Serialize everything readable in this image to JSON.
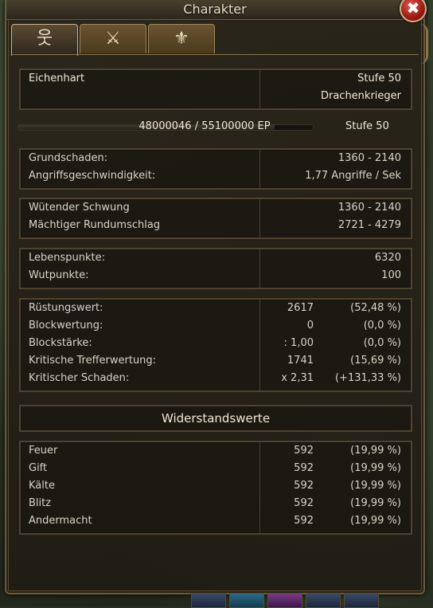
{
  "window": {
    "title": "Charakter",
    "close_symbol": "✖"
  },
  "tabs": [
    {
      "icon": "person-icon",
      "glyph": "웃",
      "active": true
    },
    {
      "icon": "crossed-swords-icon",
      "glyph": "⚔",
      "active": false
    },
    {
      "icon": "medal-icon",
      "glyph": "⚜",
      "active": false
    }
  ],
  "character": {
    "name": "Eichenhart",
    "level_label": "Stufe 50",
    "class": "Drachenkrieger"
  },
  "experience": {
    "text": "48000046 / 55100000 EP",
    "current": 48000046,
    "max": 55100000,
    "fraction": 0.8711,
    "level_label": "Stufe 50"
  },
  "damage": [
    {
      "label": "Grundschaden:",
      "value": "1360 - 2140"
    },
    {
      "label": "Angriffsgeschwindigkeit:",
      "value": "1,77 Angriffe / Sek"
    }
  ],
  "skills": [
    {
      "label": "Wütender Schwung",
      "value": "1360 - 2140"
    },
    {
      "label": "Mächtiger Rundumschlag",
      "value": "2721 - 4279"
    }
  ],
  "resources": [
    {
      "label": "Lebenspunkte:",
      "value": "6320"
    },
    {
      "label": "Wutpunkte:",
      "value": "100"
    }
  ],
  "defense": [
    {
      "label": "Rüstungswert:",
      "value": "2617",
      "pct": "(52,48 %)"
    },
    {
      "label": "Blockwertung:",
      "value": "0",
      "pct": "(0,0 %)"
    },
    {
      "label": "Blockstärke:",
      "value": ": 1,00",
      "pct": "(0,0 %)"
    },
    {
      "label": "Kritische Trefferwertung:",
      "value": "1741",
      "pct": "(15,69 %)"
    },
    {
      "label": "Kritischer Schaden:",
      "value": "x 2,31",
      "pct": "(+131,33 %)"
    }
  ],
  "resistances_title": "Widerstandswerte",
  "resistances": [
    {
      "label": "Feuer",
      "value": "592",
      "pct": "(19,99 %)"
    },
    {
      "label": "Gift",
      "value": "592",
      "pct": "(19,99 %)"
    },
    {
      "label": "Kälte",
      "value": "592",
      "pct": "(19,99 %)"
    },
    {
      "label": "Blitz",
      "value": "592",
      "pct": "(19,99 %)"
    },
    {
      "label": "Andermacht",
      "value": "592",
      "pct": "(19,99 %)"
    }
  ]
}
